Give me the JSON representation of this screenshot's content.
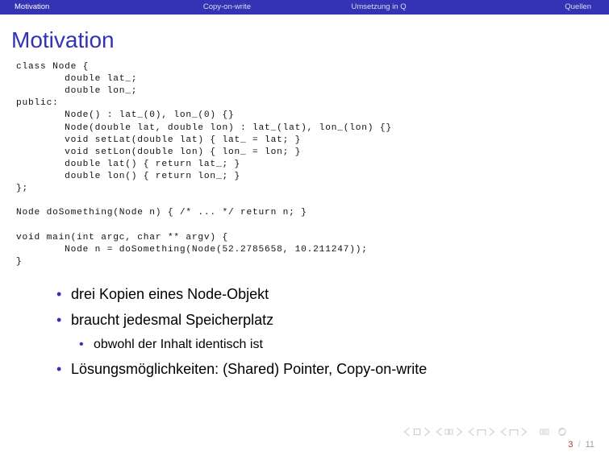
{
  "nav": {
    "tabs": [
      {
        "label": "Motivation",
        "active": true
      },
      {
        "label": "Copy-on-write",
        "active": false
      },
      {
        "label": "Umsetzung in Q",
        "active": false
      },
      {
        "label": "Quellen",
        "active": false
      }
    ]
  },
  "title": "Motivation",
  "code": "class Node {\n        double lat_;\n        double lon_;\npublic:\n        Node() : lat_(0), lon_(0) {}\n        Node(double lat, double lon) : lat_(lat), lon_(lon) {}\n        void setLat(double lat) { lat_ = lat; }\n        void setLon(double lon) { lon_ = lon; }\n        double lat() { return lat_; }\n        double lon() { return lon_; }\n};\n\nNode doSomething(Node n) { /* ... */ return n; }\n\nvoid main(int argc, char ** argv) {\n        Node n = doSomething(Node(52.2785658, 10.211247));\n}",
  "bullets": {
    "items": [
      "drei Kopien eines Node-Objekt",
      "braucht jedesmal Speicherplatz"
    ],
    "subitem": "obwohl der Inhalt identisch ist",
    "last": "Lösungsmöglichkeiten: (Shared) Pointer, Copy-on-write"
  },
  "page": {
    "current": "3",
    "sep": "/",
    "total": "11"
  }
}
